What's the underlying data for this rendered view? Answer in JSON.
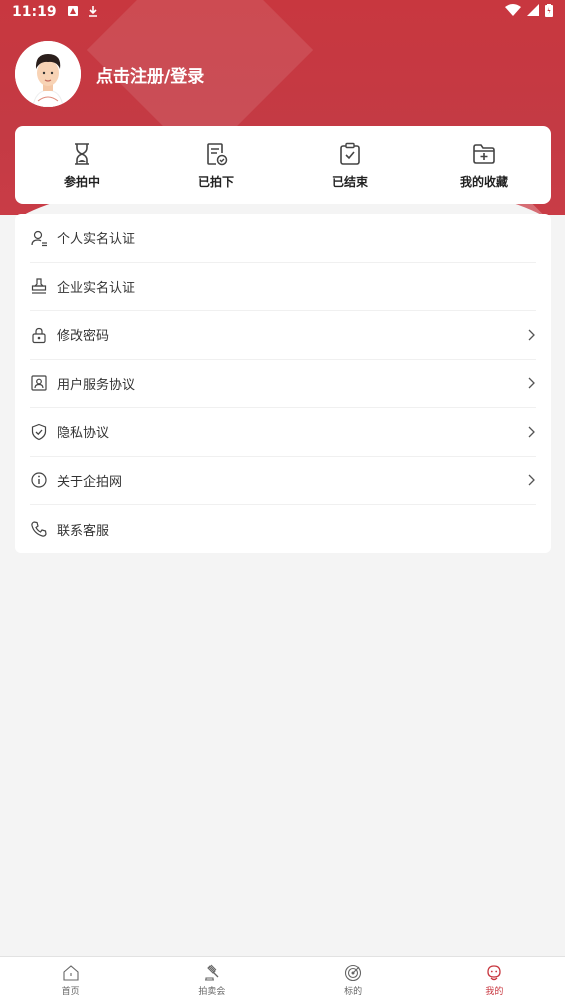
{
  "status_bar": {
    "time": "11:19"
  },
  "profile": {
    "login_text": "点击注册/登录"
  },
  "card": {
    "items": [
      {
        "label": "参拍中",
        "icon": "hourglass-icon"
      },
      {
        "label": "已拍下",
        "icon": "document-check-icon"
      },
      {
        "label": "已结束",
        "icon": "clipboard-check-icon"
      },
      {
        "label": "我的收藏",
        "icon": "folder-add-icon"
      }
    ]
  },
  "menu": {
    "items": [
      {
        "label": "个人实名认证",
        "icon": "user-verify-icon",
        "chevron": false
      },
      {
        "label": "企业实名认证",
        "icon": "stamp-icon",
        "chevron": false
      },
      {
        "label": "修改密码",
        "icon": "lock-icon",
        "chevron": true
      },
      {
        "label": "用户服务协议",
        "icon": "id-card-icon",
        "chevron": true
      },
      {
        "label": "隐私协议",
        "icon": "shield-check-icon",
        "chevron": true
      },
      {
        "label": "关于企拍网",
        "icon": "info-icon",
        "chevron": true
      },
      {
        "label": "联系客服",
        "icon": "phone-icon",
        "chevron": false
      }
    ]
  },
  "bottom_nav": {
    "items": [
      {
        "label": "首页",
        "icon": "home-icon",
        "active": false
      },
      {
        "label": "拍卖会",
        "icon": "gavel-icon",
        "active": false
      },
      {
        "label": "标的",
        "icon": "target-icon",
        "active": false
      },
      {
        "label": "我的",
        "icon": "profile-icon",
        "active": true
      }
    ]
  },
  "colors": {
    "brand": "#c8373f",
    "background": "#f4f4f4"
  }
}
